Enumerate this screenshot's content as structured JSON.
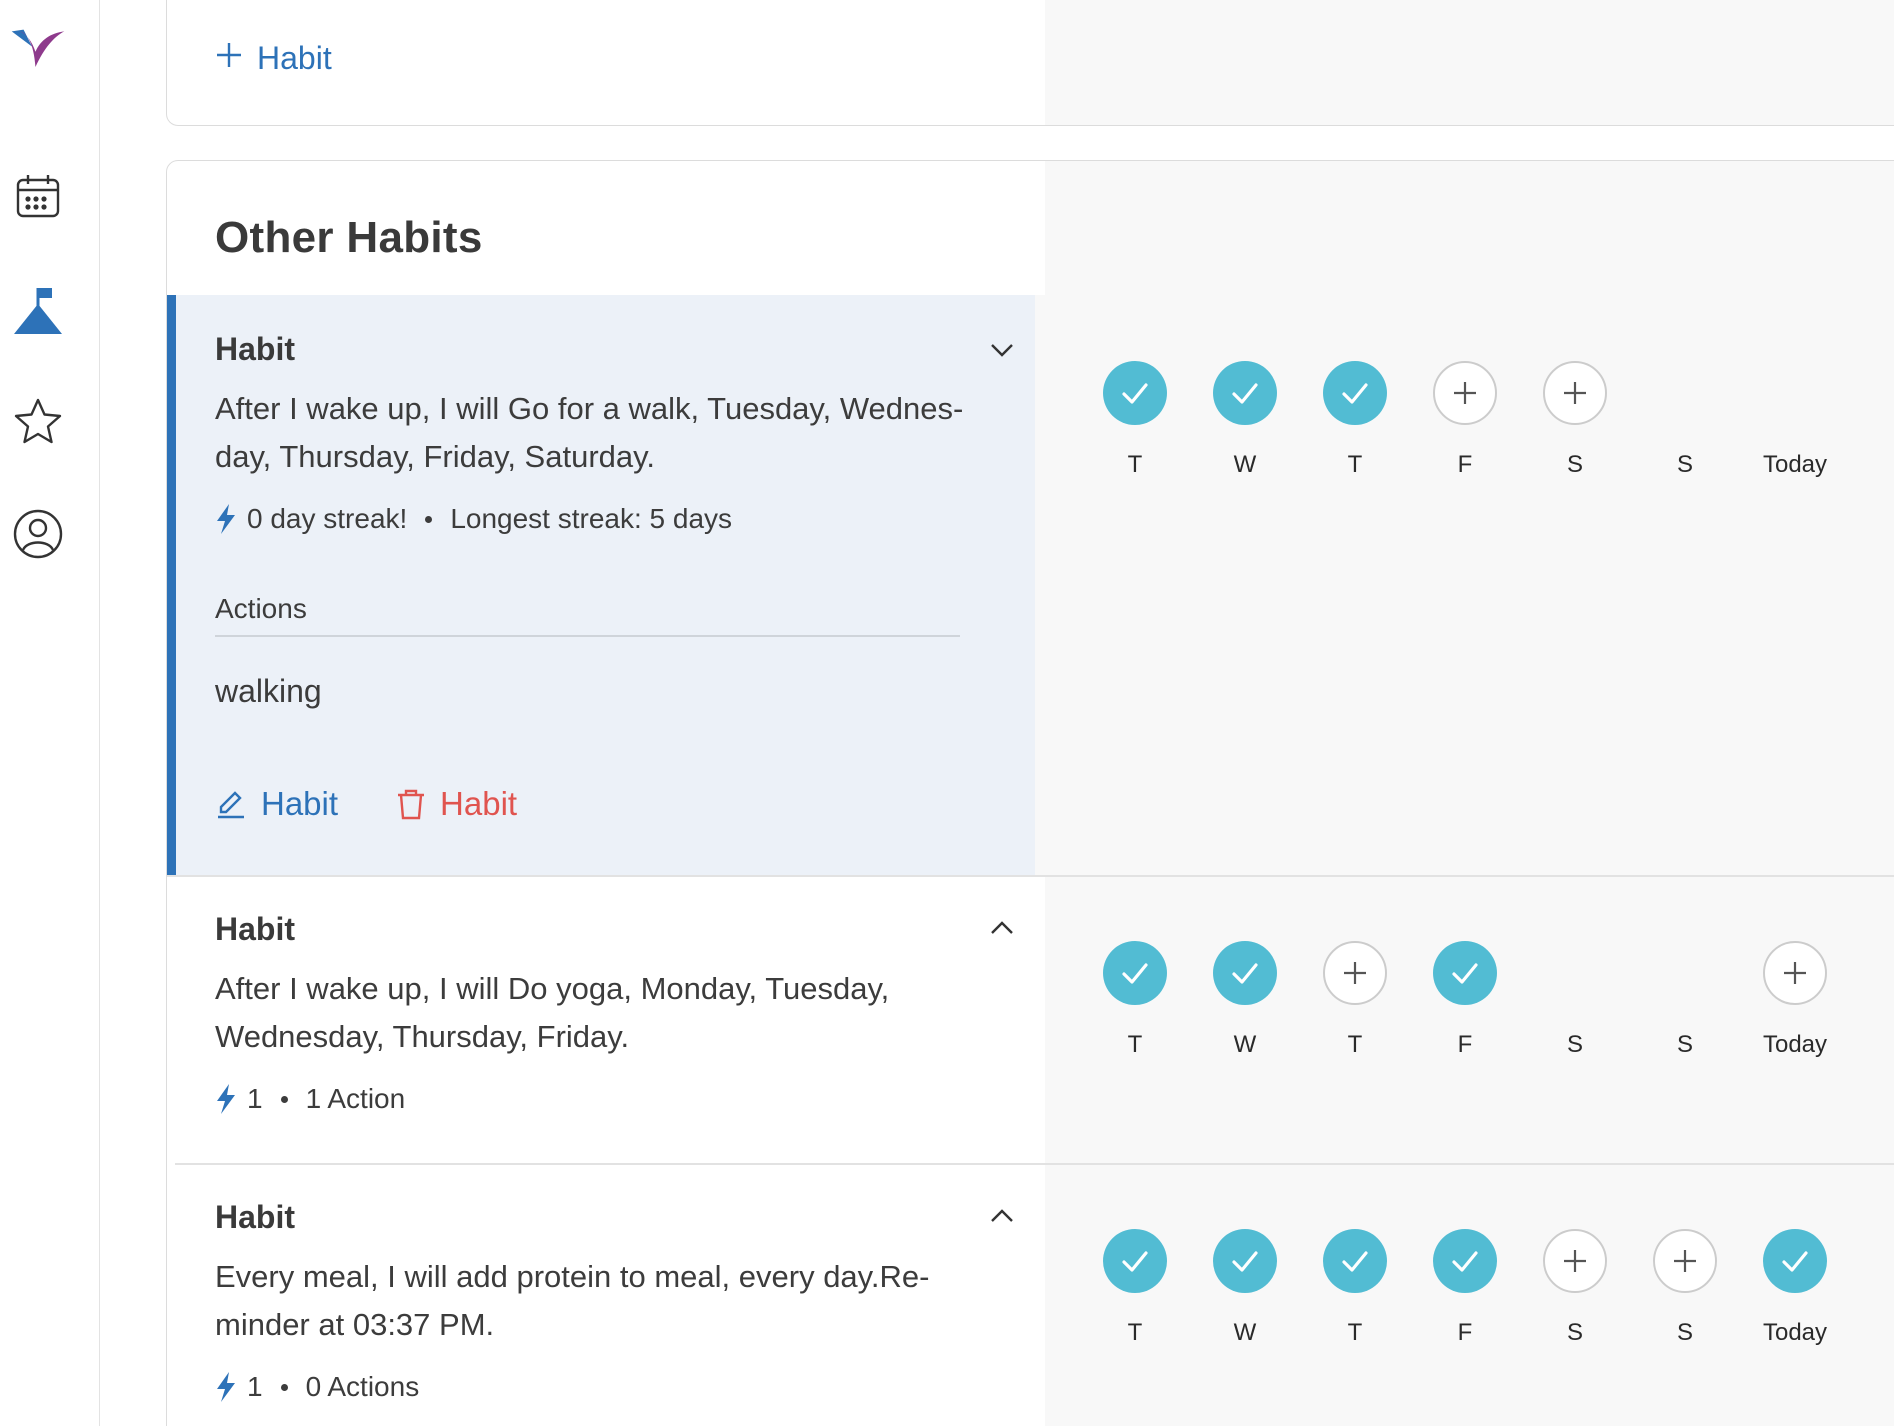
{
  "sidebar": {
    "items": [
      {
        "name": "logo",
        "icon": "brand-logo-icon"
      },
      {
        "name": "calendar",
        "icon": "calendar-icon"
      },
      {
        "name": "goals",
        "icon": "mountain-flag-icon"
      },
      {
        "name": "favorites",
        "icon": "star-icon"
      },
      {
        "name": "profile",
        "icon": "user-circle-icon"
      }
    ]
  },
  "top_card": {
    "add_habit_label": "Habit"
  },
  "other_habits": {
    "title": "Other Habits",
    "habits": [
      {
        "label": "Habit",
        "expanded": true,
        "description": "After I wake up, I will Go for a walk, Tuesday, Wednes-day, Thursday, Friday, Saturday.",
        "streak": "0 day streak!",
        "secondary": "Longest streak: 5 days",
        "actions_header": "Actions",
        "actions": [
          "walking"
        ],
        "edit_label": "Habit",
        "delete_label": "Habit",
        "days": [
          {
            "label": "T",
            "state": "done"
          },
          {
            "label": "W",
            "state": "done"
          },
          {
            "label": "T",
            "state": "done"
          },
          {
            "label": "F",
            "state": "todo"
          },
          {
            "label": "S",
            "state": "todo"
          },
          {
            "label": "S",
            "state": "empty"
          },
          {
            "label": "Today",
            "state": "empty"
          }
        ]
      },
      {
        "label": "Habit",
        "expanded": false,
        "description": "After I wake up, I will Do yoga, Monday, Tuesday, Wednesday, Thursday, Friday.",
        "streak": "1",
        "secondary": "1 Action",
        "days": [
          {
            "label": "T",
            "state": "done"
          },
          {
            "label": "W",
            "state": "done"
          },
          {
            "label": "T",
            "state": "todo"
          },
          {
            "label": "F",
            "state": "done"
          },
          {
            "label": "S",
            "state": "empty"
          },
          {
            "label": "S",
            "state": "empty"
          },
          {
            "label": "Today",
            "state": "todo"
          }
        ]
      },
      {
        "label": "Habit",
        "expanded": false,
        "description": "Every meal, I will add protein to meal, every day.Re-minder at 03:37 PM.",
        "streak": "1",
        "secondary": "0 Actions",
        "days": [
          {
            "label": "T",
            "state": "done"
          },
          {
            "label": "W",
            "state": "done"
          },
          {
            "label": "T",
            "state": "done"
          },
          {
            "label": "F",
            "state": "done"
          },
          {
            "label": "S",
            "state": "todo"
          },
          {
            "label": "S",
            "state": "todo"
          },
          {
            "label": "Today",
            "state": "done"
          }
        ]
      }
    ]
  },
  "colors": {
    "accent_blue": "#2d72b8",
    "done_teal": "#52bcd3",
    "delete_red": "#e0544f",
    "expanded_bg": "#ecf1f8",
    "panel_bg": "#f8f8f8"
  }
}
